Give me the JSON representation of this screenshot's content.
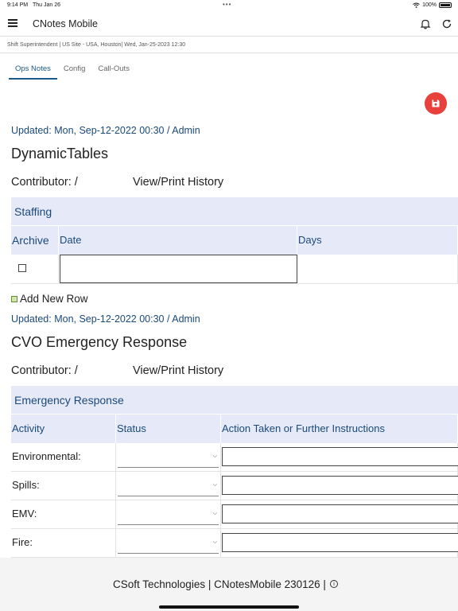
{
  "status_bar": {
    "time": "9:14 PM",
    "date": "Thu Jan 26",
    "battery": "100%"
  },
  "app": {
    "title": "CNotes Mobile"
  },
  "subheader": "Shift Superintendent | US Site - USA, Houston| Wed, Jan-25-2023 12:30",
  "tabs": [
    {
      "label": "Ops Notes",
      "active": true
    },
    {
      "label": "Config",
      "active": false
    },
    {
      "label": "Call-Outs",
      "active": false
    }
  ],
  "sections": [
    {
      "updated": "Updated: Mon, Sep-12-2022 00:30 / Admin",
      "title": "DynamicTables",
      "contributor_label": "Contributor:  /",
      "history_label": "View/Print History",
      "grid_title": "Staffing",
      "columns": [
        "Archive",
        "Date",
        "Days"
      ],
      "add_row": "Add New Row"
    },
    {
      "updated": "Updated: Mon, Sep-12-2022 00:30 / Admin",
      "title": "CVO Emergency Response",
      "contributor_label": "Contributor:  /",
      "history_label": "View/Print History",
      "grid_title": "Emergency Response",
      "columns": [
        "Activity",
        "Status",
        "Action Taken or Further Instructions"
      ],
      "rows": [
        "Environmental:",
        "Spills:",
        "EMV:",
        "Fire:"
      ]
    }
  ],
  "footer": {
    "text": "CSoft Technologies | CNotesMobile  230126 |"
  },
  "colors": {
    "accent": "#1a5a8a",
    "save_button": "#e8403a",
    "grid_header": "#e6e9f8"
  },
  "icons": [
    "menu-icon",
    "bell-icon",
    "refresh-icon",
    "save-icon",
    "info-icon",
    "add-row-icon",
    "chevron-down-icon"
  ]
}
